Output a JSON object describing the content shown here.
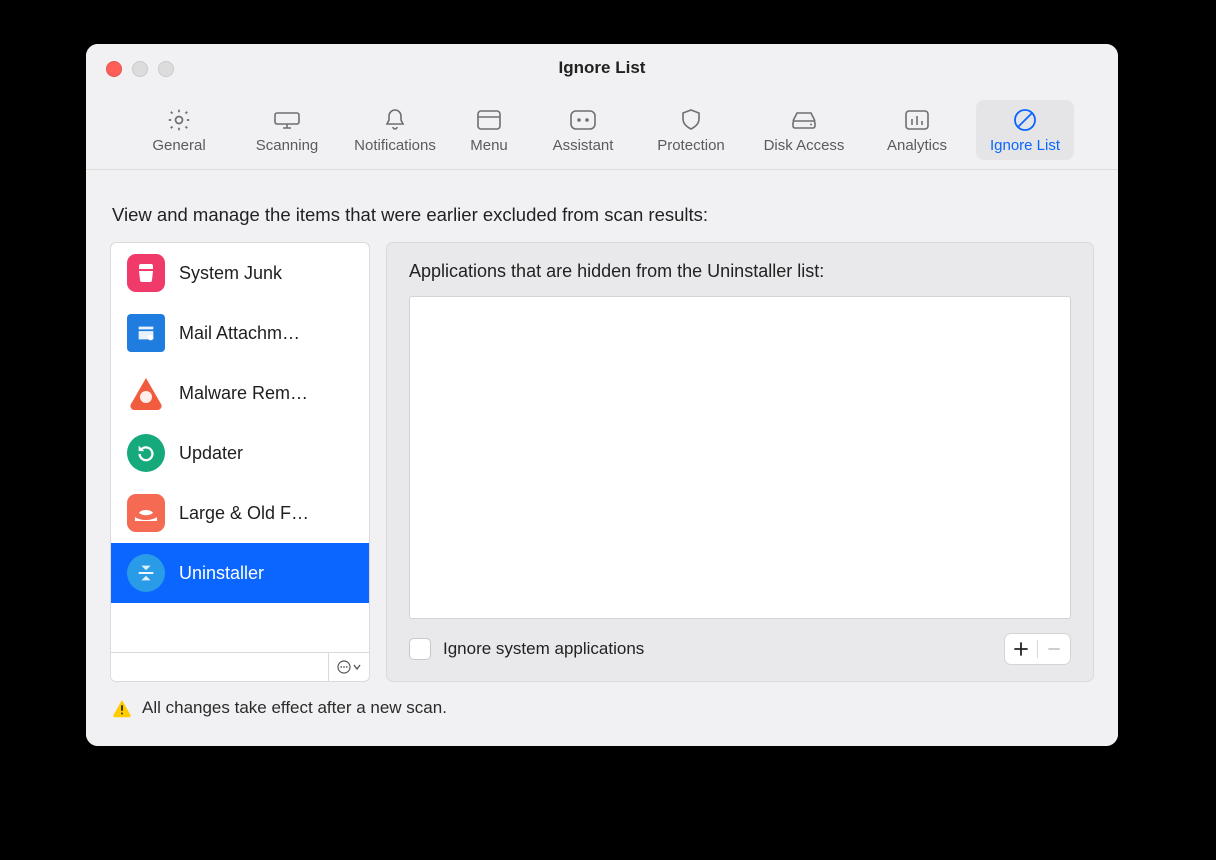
{
  "window": {
    "title": "Ignore List"
  },
  "toolbar": {
    "items": [
      {
        "label": "General",
        "icon": "gear"
      },
      {
        "label": "Scanning",
        "icon": "monitor"
      },
      {
        "label": "Notifications",
        "icon": "bell"
      },
      {
        "label": "Menu",
        "icon": "panel"
      },
      {
        "label": "Assistant",
        "icon": "face"
      },
      {
        "label": "Protection",
        "icon": "shield"
      },
      {
        "label": "Disk Access",
        "icon": "disk"
      },
      {
        "label": "Analytics",
        "icon": "bars"
      },
      {
        "label": "Ignore List",
        "icon": "forbid"
      }
    ],
    "active_index": 8
  },
  "heading": "View and manage the items that were earlier excluded from scan results:",
  "categories": {
    "items": [
      {
        "label": "System Junk",
        "icon_bg": "#ef3a6a",
        "glyph": "junk"
      },
      {
        "label": "Mail Attachm…",
        "icon_bg": "#1f7de0",
        "glyph": "mail"
      },
      {
        "label": "Malware Rem…",
        "icon_bg": "#f25c3e",
        "glyph": "biohazard"
      },
      {
        "label": "Updater",
        "icon_bg": "#16a97c",
        "glyph": "update"
      },
      {
        "label": "Large & Old F…",
        "icon_bg": "#f46a52",
        "glyph": "whale"
      },
      {
        "label": "Uninstaller",
        "icon_bg": "#2a9be6",
        "glyph": "uninstall"
      }
    ],
    "selected_index": 5
  },
  "detail": {
    "subheading": "Applications that are hidden from the Uninstaller list:",
    "checkbox_label": "Ignore system applications",
    "checkbox_checked": false
  },
  "footer_note": "All changes take effect after a new scan."
}
